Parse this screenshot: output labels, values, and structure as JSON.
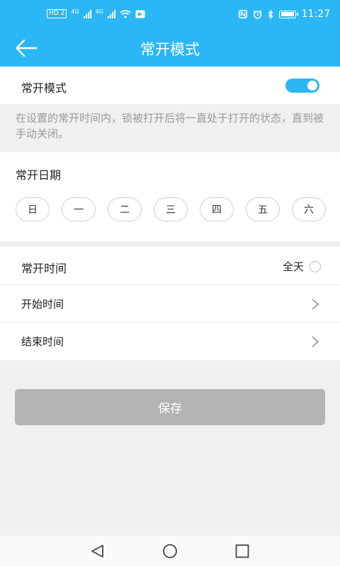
{
  "status_bar": {
    "left_badge": "HD 2",
    "net1": "4G",
    "net2": "4G",
    "time": "11:27",
    "icons": [
      "nfc-icon",
      "alarm-icon",
      "bluetooth-icon",
      "battery-icon"
    ]
  },
  "app_bar": {
    "title": "常开模式",
    "back_icon": "arrow-left-icon"
  },
  "mode": {
    "label": "常开模式",
    "enabled": true
  },
  "description": "在设置的常开时间内，锁被打开后将一直处于打开的状态，直到被手动关闭。",
  "days": {
    "title": "常开日期",
    "items": [
      "日",
      "一",
      "二",
      "三",
      "四",
      "五",
      "六"
    ]
  },
  "time_section": {
    "title": "常开时间",
    "all_day_label": "全天",
    "all_day_selected": false,
    "start_label": "开始时间",
    "end_label": "结束时间"
  },
  "save_label": "保存",
  "colors": {
    "primary": "#2bb7f5",
    "button_disabled": "#b3b3b3",
    "background": "#f0f0f0"
  }
}
